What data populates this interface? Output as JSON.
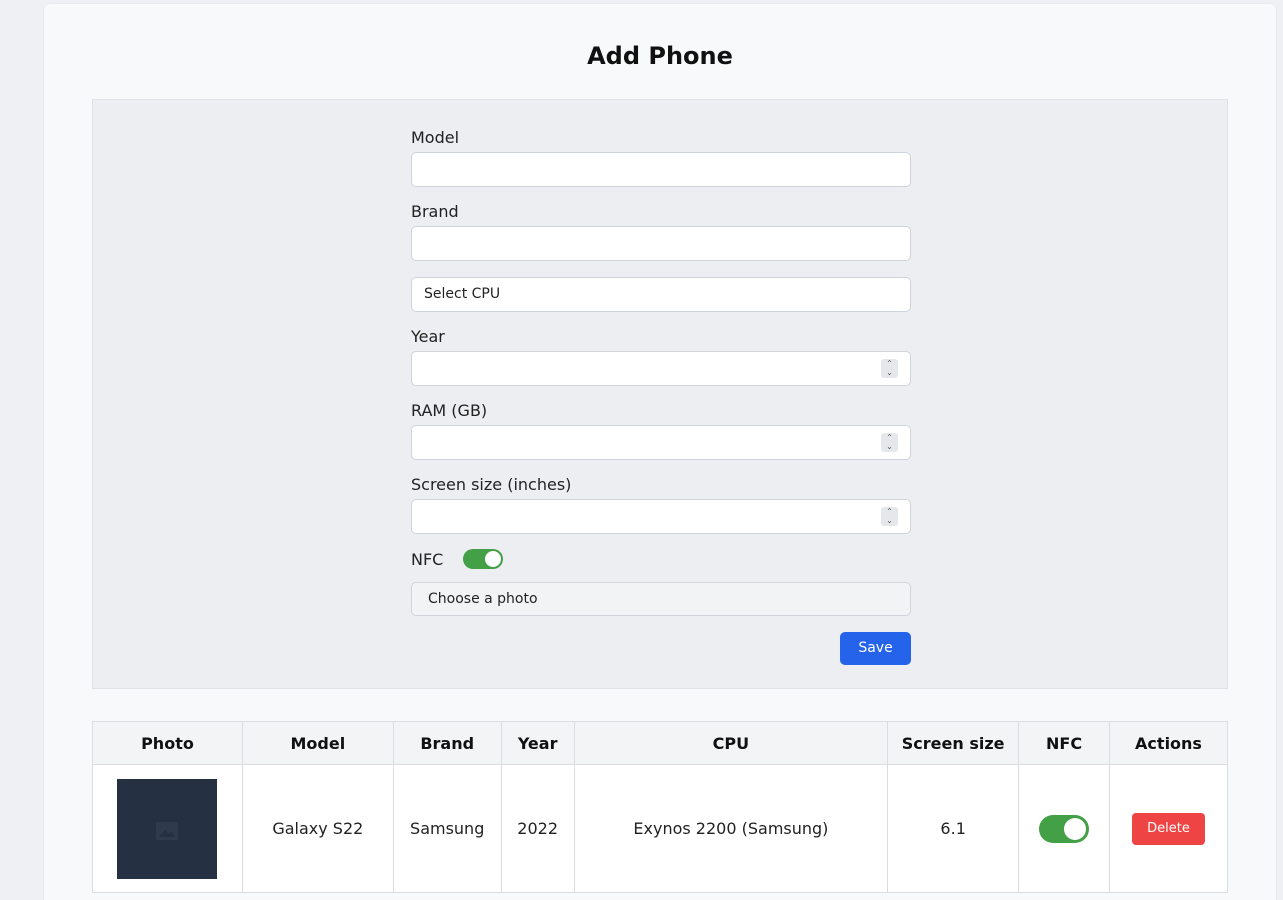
{
  "page": {
    "title": "Add Phone"
  },
  "form": {
    "model_label": "Model",
    "model_value": "",
    "brand_label": "Brand",
    "brand_value": "",
    "cpu_select": "Select CPU",
    "year_label": "Year",
    "year_value": "",
    "ram_label": "RAM (GB)",
    "ram_value": "",
    "screen_label": "Screen size (inches)",
    "screen_value": "",
    "nfc_label": "NFC",
    "nfc_on": true,
    "photo_button": "Choose a photo",
    "save_button": "Save"
  },
  "table": {
    "headers": [
      "Photo",
      "Model",
      "Brand",
      "Year",
      "CPU",
      "Screen size",
      "NFC",
      "Actions"
    ],
    "rows": [
      {
        "photo_icon": "image-placeholder-icon",
        "model": "Galaxy S22",
        "brand": "Samsung",
        "year": "2022",
        "cpu": "Exynos 2200 (Samsung)",
        "screen_size": "6.1",
        "nfc_on": true,
        "action": "Delete"
      }
    ]
  },
  "colors": {
    "accent": "#2563eb",
    "toggle_on": "#43a047",
    "danger": "#ef4444",
    "photo_bg": "#253142"
  }
}
